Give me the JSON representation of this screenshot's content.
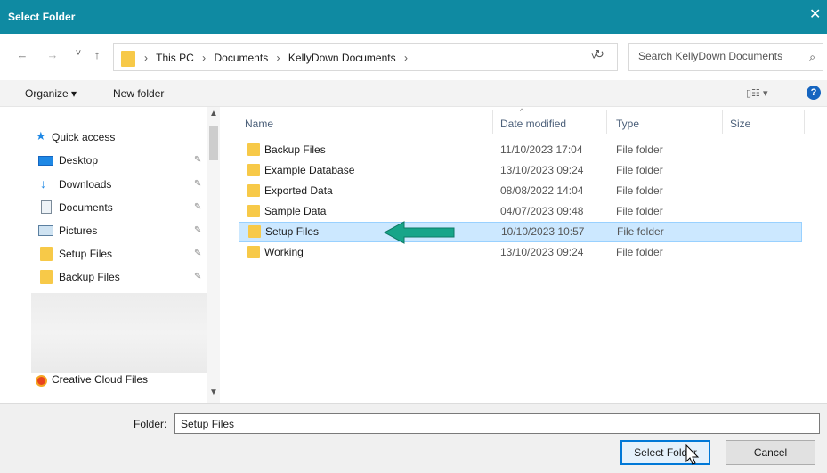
{
  "window": {
    "title": "Select Folder",
    "close": "✕"
  },
  "nav": {
    "back": "←",
    "forward": "→",
    "recent": "˅",
    "up": "↑"
  },
  "address": {
    "crumbs": [
      "This PC",
      "Documents",
      "KellyDown Documents"
    ],
    "sep": "›",
    "dropdown": "˅",
    "refresh": "↻"
  },
  "search": {
    "placeholder": "Search KellyDown Documents",
    "icon": "⌕"
  },
  "toolbar": {
    "organize": "Organize ▾",
    "new_folder": "New folder",
    "view": "▯☷ ▾",
    "help": "?"
  },
  "sidebar": {
    "items": [
      {
        "label": "Quick access",
        "icon": "star-icon"
      },
      {
        "label": "Desktop",
        "icon": "desktop-icon",
        "pinned": true
      },
      {
        "label": "Downloads",
        "icon": "downloads-icon",
        "pinned": true
      },
      {
        "label": "Documents",
        "icon": "documents-icon",
        "pinned": true
      },
      {
        "label": "Pictures",
        "icon": "pictures-icon",
        "pinned": true
      },
      {
        "label": "Setup Files",
        "icon": "folder-icon",
        "pinned": true
      },
      {
        "label": "Backup Files",
        "icon": "folder-icon",
        "pinned": true
      },
      {
        "label": "Creative Cloud Files",
        "icon": "creative-cloud-icon"
      }
    ],
    "pin_glyph": "📌"
  },
  "columns": {
    "name": "Name",
    "date": "Date modified",
    "type": "Type",
    "size": "Size"
  },
  "files": [
    {
      "name": "Backup Files",
      "date": "11/10/2023 17:04",
      "type": "File folder"
    },
    {
      "name": "Example Database",
      "date": "13/10/2023 09:24",
      "type": "File folder"
    },
    {
      "name": "Exported Data",
      "date": "08/08/2022 14:04",
      "type": "File folder"
    },
    {
      "name": "Sample Data",
      "date": "04/07/2023 09:48",
      "type": "File folder"
    },
    {
      "name": "Setup Files",
      "date": "10/10/2023 10:57",
      "type": "File folder",
      "selected": true
    },
    {
      "name": "Working",
      "date": "13/10/2023 09:24",
      "type": "File folder"
    }
  ],
  "footer": {
    "folder_label": "Folder:",
    "folder_value": "Setup Files",
    "select_button": "Select Folder",
    "cancel_button": "Cancel"
  },
  "colors": {
    "titlebar": "#0f8aa2",
    "selection": "#cce8ff",
    "arrow": "#17a589",
    "folder": "#f7c948"
  }
}
